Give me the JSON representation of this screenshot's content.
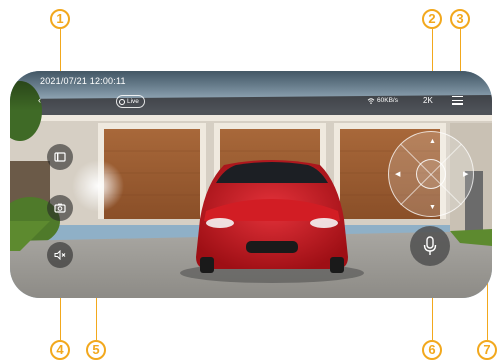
{
  "callouts": {
    "c1": "1",
    "c2": "2",
    "c3": "3",
    "c4": "4",
    "c5": "5",
    "c6": "6",
    "c7": "7"
  },
  "live_view": {
    "timestamp": "2021/07/21  12:00:11",
    "live_label": "Live",
    "network_speed": "60KB/s",
    "video_quality": "2K",
    "icons": [
      "back-arrow-icon",
      "wifi-icon",
      "menu-icon",
      "fullscreen-icon",
      "camera-icon",
      "speaker-mute-icon",
      "microphone-icon"
    ]
  },
  "colors": {
    "callout": "#f2a81d",
    "car": "#c8151b"
  }
}
